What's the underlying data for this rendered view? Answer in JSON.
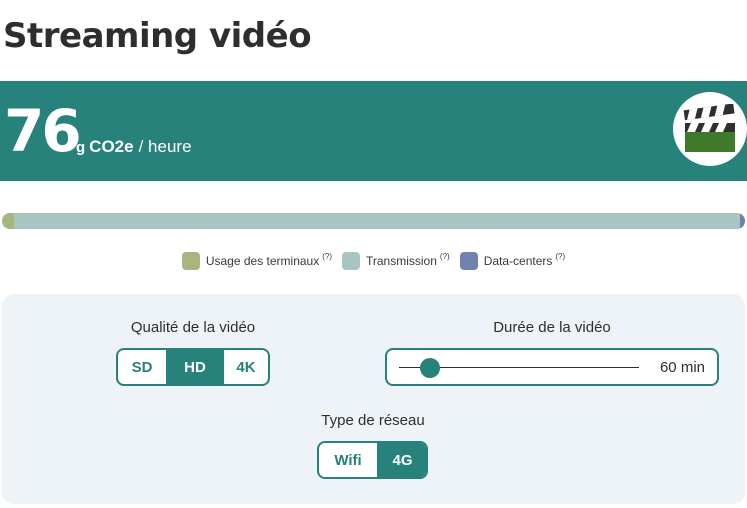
{
  "page": {
    "title": "Streaming vidéo"
  },
  "footprint": {
    "value": "76",
    "unit_g": "g",
    "unit_co2": "CO2e",
    "unit_per": "/ heure",
    "icon": "clapperboard-icon",
    "banner_color": "#26827b"
  },
  "breakdown": {
    "segments": [
      {
        "key": "terminaux",
        "share": 0.016,
        "color": "#a8b57f"
      },
      {
        "key": "transmission",
        "share": 0.977,
        "color": "#a9c5c2"
      },
      {
        "key": "datacenters",
        "share": 0.007,
        "color": "#6f82ad"
      }
    ]
  },
  "legend": {
    "items": [
      {
        "label": "Usage des terminaux",
        "help": "(?)",
        "color": "#a8b57f"
      },
      {
        "label": "Transmission",
        "help": "(?)",
        "color": "#a9c5c2"
      },
      {
        "label": "Data-centers",
        "help": "(?)",
        "color": "#6f82ad"
      }
    ]
  },
  "controls": {
    "quality": {
      "label": "Qualité de la vidéo",
      "options": [
        "SD",
        "HD",
        "4K"
      ],
      "selected": "HD"
    },
    "duration": {
      "label": "Durée de la vidéo",
      "value_label": "60 min",
      "level": 0.13
    },
    "network": {
      "label": "Type de réseau",
      "options": [
        "Wifi",
        "4G"
      ],
      "selected": "4G"
    }
  }
}
